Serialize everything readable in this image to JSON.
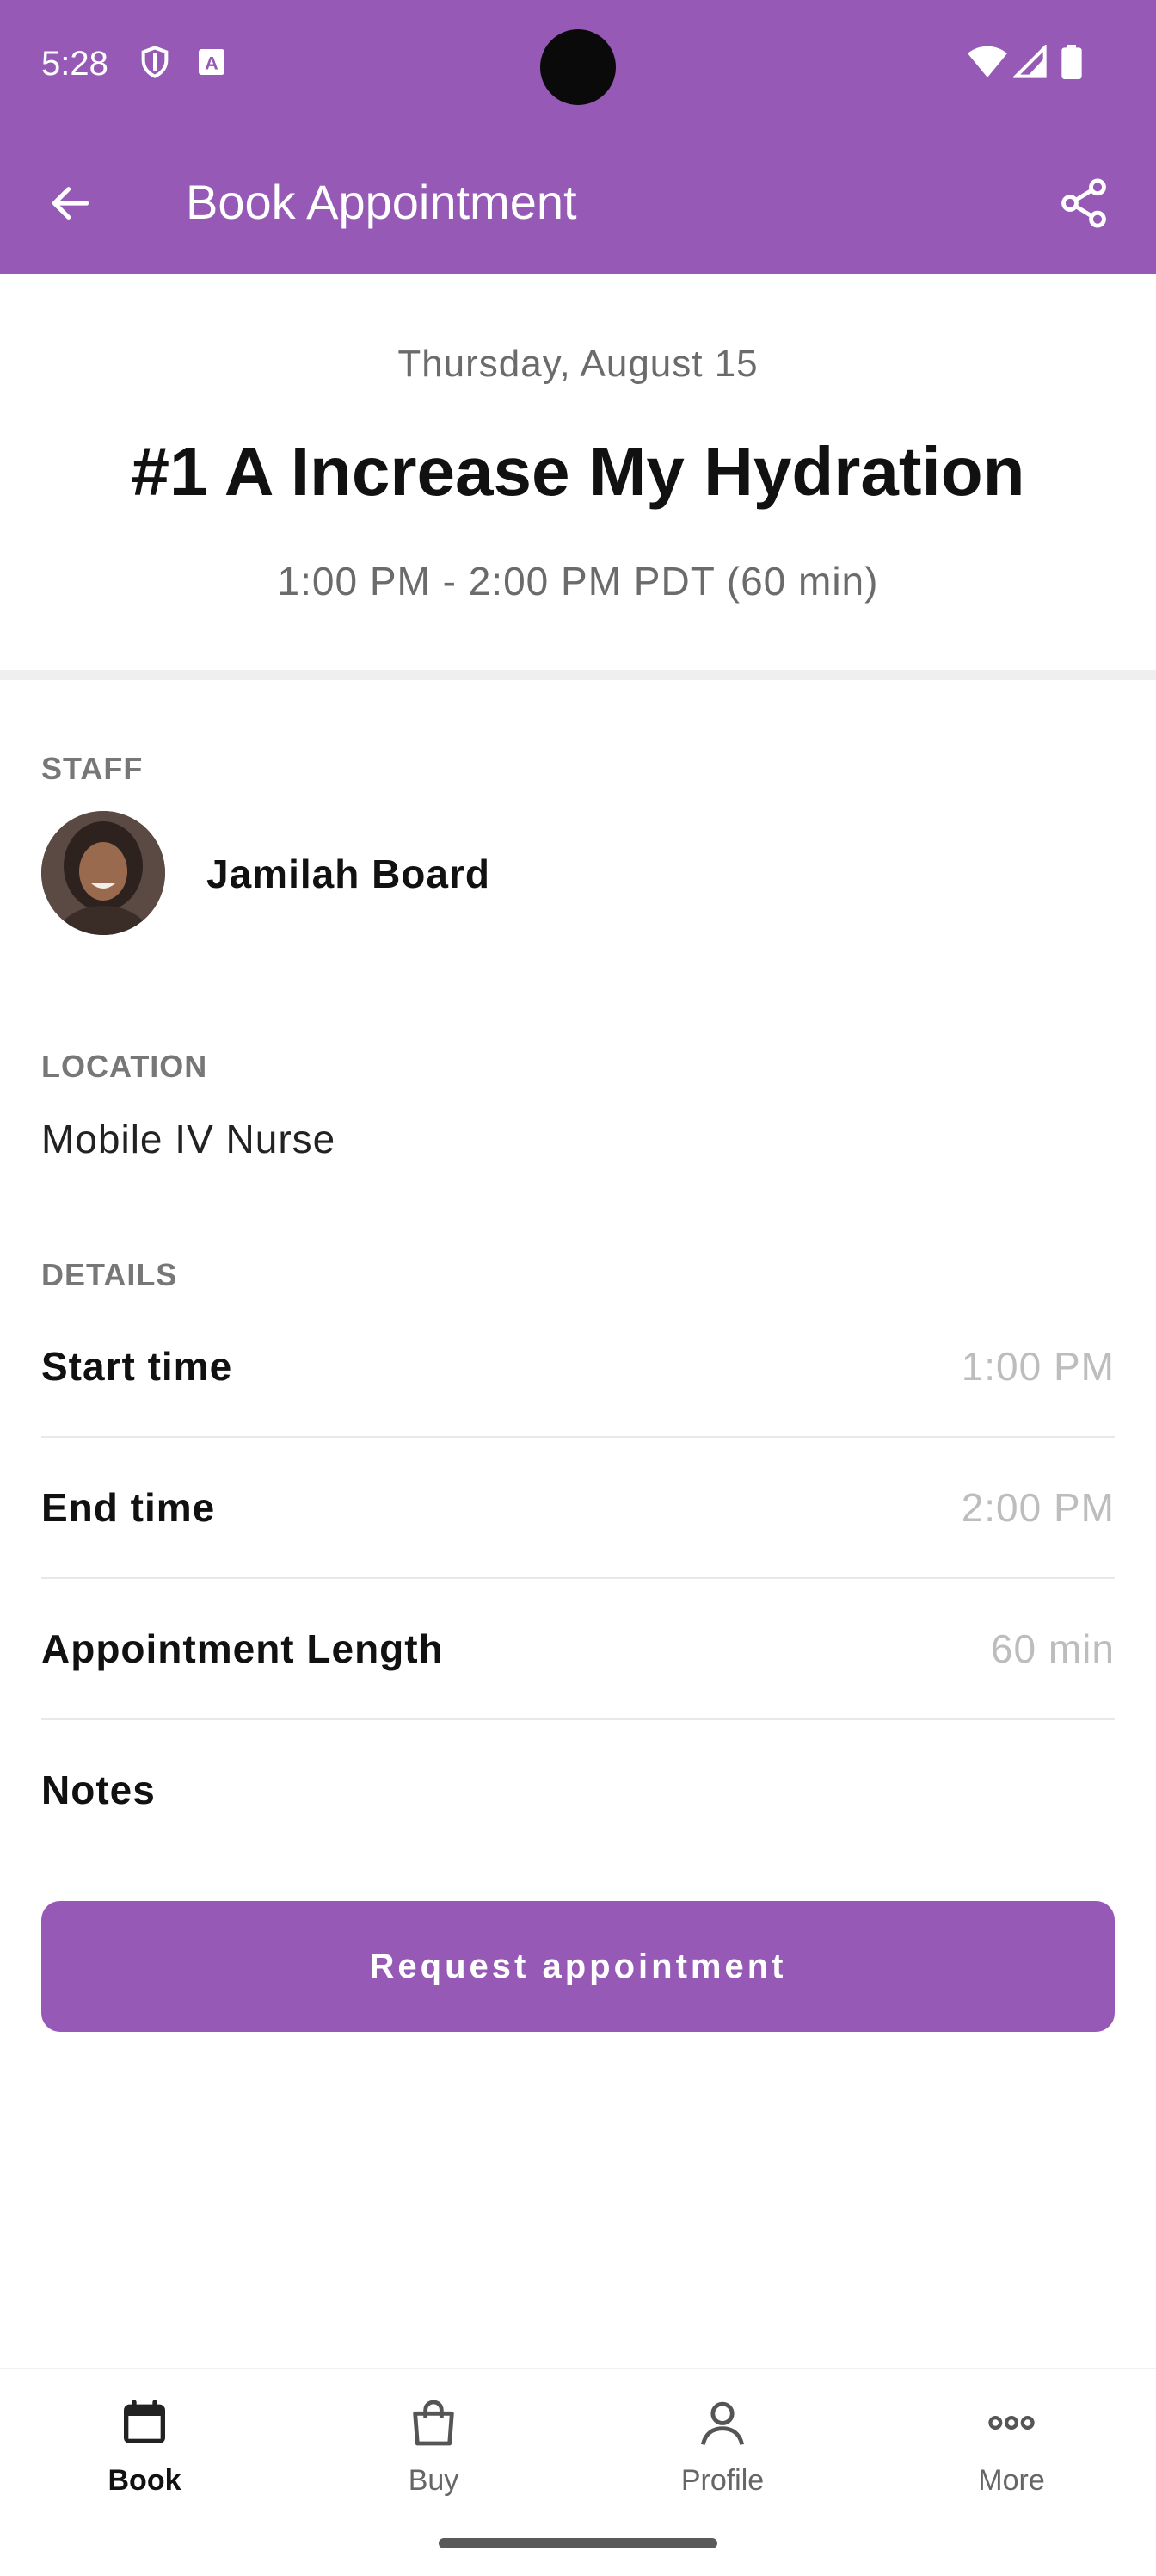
{
  "status_bar": {
    "time": "5:28",
    "icons": [
      "shield-icon",
      "font-a-icon",
      "wifi-icon",
      "signal-icon",
      "battery-icon"
    ]
  },
  "app_bar": {
    "title": "Book Appointment",
    "back_icon": "arrow-left-icon",
    "share_icon": "share-icon",
    "background": "#9659b5"
  },
  "appointment": {
    "date": "Thursday, August 15",
    "title": "#1 A Increase My Hydration",
    "time_range": "1:00 PM - 2:00 PM PDT (60 min)"
  },
  "staff": {
    "label": "STAFF",
    "name": "Jamilah Board"
  },
  "location": {
    "label": "LOCATION",
    "value": "Mobile IV Nurse"
  },
  "details": {
    "label": "DETAILS",
    "rows": [
      {
        "label": "Start time",
        "value": "1:00 PM"
      },
      {
        "label": "End time",
        "value": "2:00 PM"
      },
      {
        "label": "Appointment Length",
        "value": "60 min"
      },
      {
        "label": "Notes",
        "value": ""
      }
    ]
  },
  "request_button": {
    "label": "Request appointment"
  },
  "bottom_nav": {
    "items": [
      {
        "label": "Book",
        "icon": "calendar-icon",
        "active": true
      },
      {
        "label": "Buy",
        "icon": "shopping-bag-icon",
        "active": false
      },
      {
        "label": "Profile",
        "icon": "person-icon",
        "active": false
      },
      {
        "label": "More",
        "icon": "more-dots-icon",
        "active": false
      }
    ]
  },
  "colors": {
    "accent": "#9659b5",
    "muted_text": "#6b6b6b",
    "value_text": "#bdbdbd"
  }
}
